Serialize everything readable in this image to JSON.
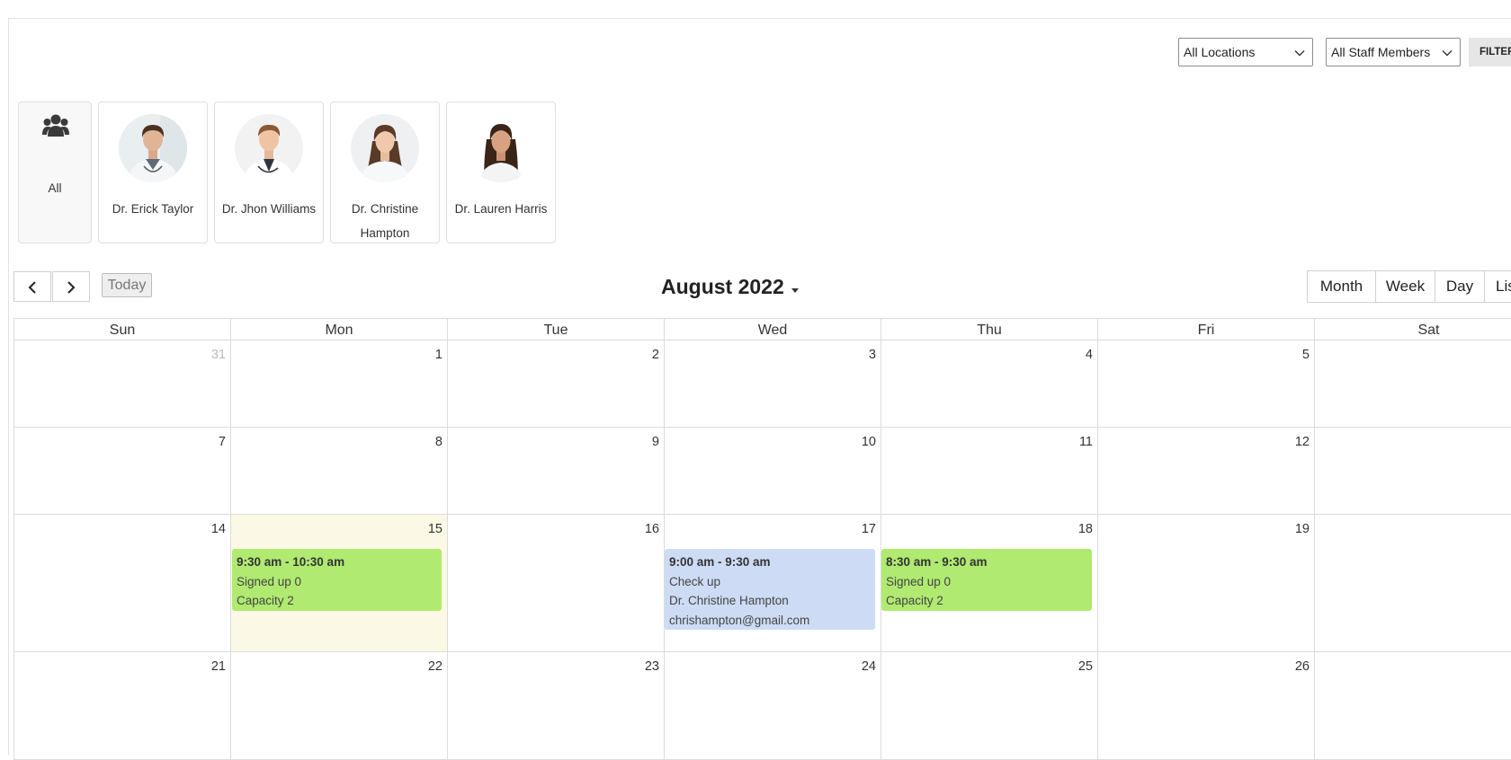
{
  "filters": {
    "location": "All Locations",
    "staff": "All Staff Members",
    "filter_label": "FILTER"
  },
  "staff": [
    {
      "name": "All",
      "icon": "users-icon"
    },
    {
      "name": "Dr. Erick Taylor"
    },
    {
      "name": "Dr. Jhon Williams"
    },
    {
      "name": "Dr. Christine Hampton"
    },
    {
      "name": "Dr. Lauren Harris"
    }
  ],
  "toolbar": {
    "today_label": "Today",
    "title": "August 2022",
    "views": [
      "Month",
      "Week",
      "Day",
      "Lis"
    ]
  },
  "weekdays": [
    "Sun",
    "Mon",
    "Tue",
    "Wed",
    "Thu",
    "Fri",
    "Sat"
  ],
  "weeks": [
    [
      "31",
      "1",
      "2",
      "3",
      "4",
      "5",
      ""
    ],
    [
      "7",
      "8",
      "9",
      "10",
      "11",
      "12",
      ""
    ],
    [
      "14",
      "15",
      "16",
      "17",
      "18",
      "19",
      ""
    ],
    [
      "21",
      "22",
      "23",
      "24",
      "25",
      "26",
      ""
    ]
  ],
  "events": {
    "mon15": {
      "time": "9:30 am - 10:30 am",
      "line1": "Signed up 0",
      "line2": "Capacity 2",
      "color": "#b0ea71"
    },
    "wed17": {
      "time": "9:00 am - 9:30 am",
      "line1": "Check up",
      "line2": "Dr. Christine Hampton",
      "line3": "chrishampton@gmail.com",
      "color": "#cddcf4"
    },
    "thu18": {
      "time": "8:30 am - 9:30 am",
      "line1": "Signed up 0",
      "line2": "Capacity 2",
      "color": "#b0ea71"
    }
  },
  "colors": {
    "today_highlight": "#fcf8e6"
  }
}
